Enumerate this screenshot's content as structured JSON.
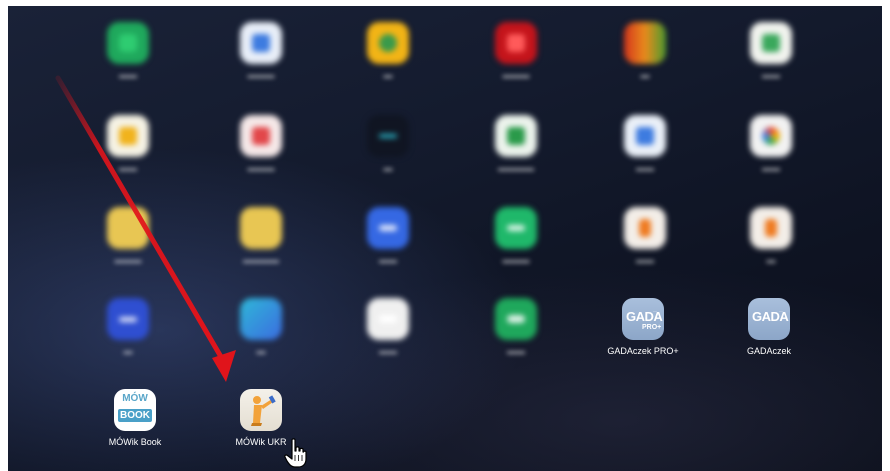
{
  "apps_sharp": [
    {
      "name": "GADAczek PRO+",
      "logo_text": "GADA",
      "logo_badge": "PRO+"
    },
    {
      "name": "GADAczek",
      "logo_text": "GADA"
    },
    {
      "name": "MÓWik Book",
      "logo_top": "MÓW",
      "logo_word": "BOOK"
    },
    {
      "name": "MÓWik UKR"
    }
  ],
  "colors": {
    "gadaczek_tile": "#9fb6d6",
    "mowik_book_band": "#4aa0c8",
    "mowik_ukr_figure": "#f2a23a",
    "annotation_arrow": "#e0141b"
  },
  "icons": {
    "cursor": "hand-pointer-icon",
    "annotation": "red-arrow-icon"
  }
}
